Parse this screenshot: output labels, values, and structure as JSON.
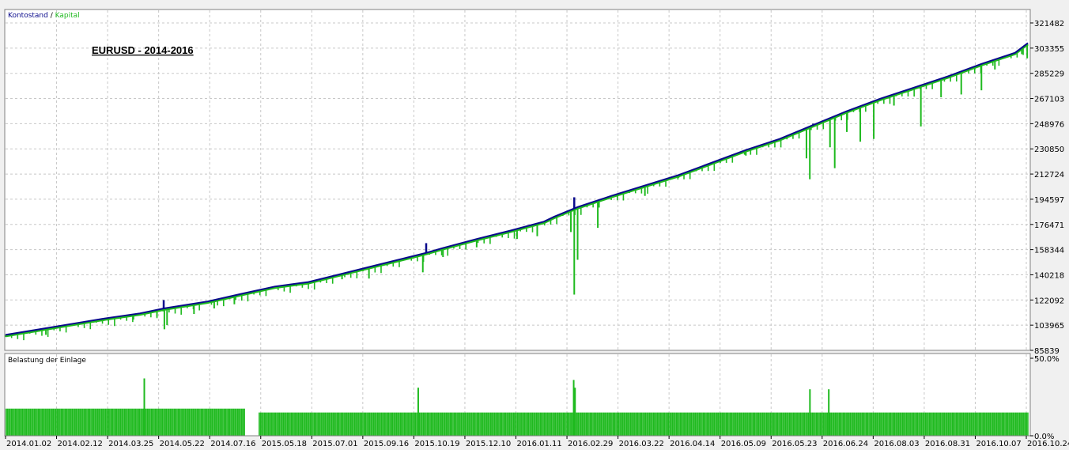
{
  "colors": {
    "balance": "#0a0a8c",
    "equity": "#1fba1f",
    "load": "#1fba1f",
    "grid": "#c8c8c8",
    "frame": "#7f7f7f",
    "panel_bg": "#ffffff"
  },
  "chart_data": [
    {
      "type": "line",
      "legend": {
        "balance": "Kontostand",
        "separator": " / ",
        "equity": "Kapital"
      },
      "annotation": "EURUSD - 2014-2016",
      "y_ticks": [
        "321482",
        "303355",
        "285229",
        "267103",
        "248976",
        "230850",
        "212724",
        "194597",
        "176471",
        "158344",
        "140218",
        "122092",
        "103965",
        "85839"
      ],
      "ylim": [
        85839,
        321482
      ],
      "trade_range": [
        0,
        1000
      ],
      "balance": [
        [
          0,
          97000
        ],
        [
          50,
          101000
        ],
        [
          100,
          105000
        ],
        [
          150,
          109000
        ],
        [
          200,
          112500
        ],
        [
          235,
          116000
        ],
        [
          300,
          121000
        ],
        [
          350,
          126500
        ],
        [
          400,
          131800
        ],
        [
          450,
          135000
        ],
        [
          500,
          141000
        ],
        [
          550,
          147000
        ],
        [
          600,
          153000
        ],
        [
          625,
          156000
        ],
        [
          650,
          159500
        ],
        [
          700,
          166000
        ],
        [
          750,
          172000
        ],
        [
          800,
          178500
        ],
        [
          815,
          182000
        ],
        [
          850,
          189000
        ],
        [
          900,
          197000
        ],
        [
          1000,
          212000
        ],
        [
          1050,
          221000
        ],
        [
          1100,
          230000
        ],
        [
          1150,
          238000
        ],
        [
          1200,
          248000
        ],
        [
          1250,
          258000
        ],
        [
          1300,
          267000
        ],
        [
          1350,
          275000
        ],
        [
          1400,
          283000
        ],
        [
          1450,
          292000
        ],
        [
          1500,
          300000
        ],
        [
          1519,
          307000
        ]
      ],
      "balance_spikes": [
        [
          235,
          122000
        ],
        [
          625,
          163000
        ],
        [
          845,
          196000
        ],
        [
          1200,
          249000
        ],
        [
          1230,
          254000
        ]
      ],
      "equity_dips": [
        [
          0,
          97000
        ],
        [
          60,
          97000
        ],
        [
          120,
          106000
        ],
        [
          190,
          108000
        ],
        [
          225,
          110000
        ],
        [
          236,
          101000
        ],
        [
          240,
          104000
        ],
        [
          280,
          112000
        ],
        [
          310,
          116000
        ],
        [
          340,
          119000
        ],
        [
          380,
          130000
        ],
        [
          440,
          134000
        ],
        [
          500,
          137000
        ],
        [
          540,
          137500
        ],
        [
          620,
          142000
        ],
        [
          650,
          153000
        ],
        [
          700,
          160000
        ],
        [
          760,
          166000
        ],
        [
          790,
          168000
        ],
        [
          840,
          171000
        ],
        [
          845,
          126000
        ],
        [
          850,
          151000
        ],
        [
          880,
          174000
        ],
        [
          950,
          197000
        ],
        [
          1000,
          210000
        ],
        [
          1100,
          226000
        ],
        [
          1190,
          224000
        ],
        [
          1195,
          209000
        ],
        [
          1225,
          232000
        ],
        [
          1232,
          217000
        ],
        [
          1250,
          243000
        ],
        [
          1270,
          236000
        ],
        [
          1290,
          238000
        ],
        [
          1320,
          262000
        ],
        [
          1360,
          247000
        ],
        [
          1390,
          268000
        ],
        [
          1420,
          270000
        ],
        [
          1450,
          273000
        ],
        [
          1470,
          288000
        ],
        [
          1510,
          299000
        ],
        [
          1518,
          296000
        ]
      ]
    },
    {
      "type": "bar",
      "legend": "Belastung der Einlage",
      "y_ticks": [
        "50.0%",
        "0.0%"
      ],
      "ylim": [
        0,
        50
      ],
      "baseline_level": 17.5,
      "gap_level": 15,
      "gap_range": [
        355,
        376
      ],
      "spikes": [
        [
          205,
          37
        ],
        [
          612,
          31
        ],
        [
          843,
          36
        ],
        [
          845,
          31
        ],
        [
          1194,
          30
        ],
        [
          1222,
          30
        ]
      ],
      "x_ticks": [
        "2014.01.02",
        "2014.02.12",
        "2014.03.25",
        "2014.05.22",
        "2014.07.16",
        "2015.05.18",
        "2015.07.01",
        "2015.09.16",
        "2015.10.19",
        "2015.12.10",
        "2016.01.11",
        "2016.02.29",
        "2016.03.22",
        "2016.04.14",
        "2016.05.09",
        "2016.05.23",
        "2016.06.24",
        "2016.08.03",
        "2016.08.31",
        "2016.10.07",
        "2016.10.24"
      ]
    }
  ]
}
